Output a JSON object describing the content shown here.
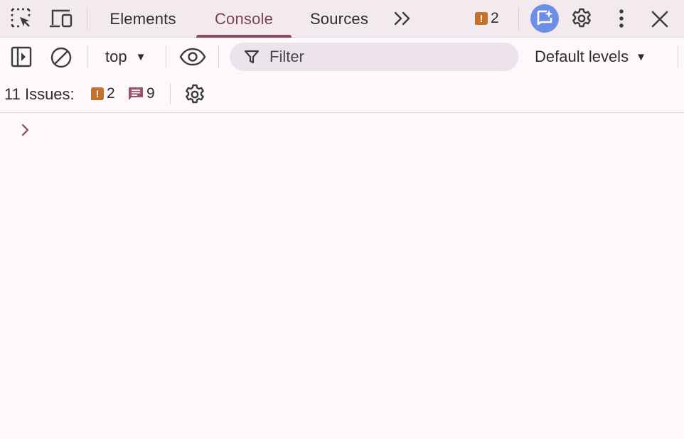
{
  "tabs": [
    {
      "label": "Elements",
      "active": false
    },
    {
      "label": "Console",
      "active": true
    },
    {
      "label": "Sources",
      "active": false
    }
  ],
  "header": {
    "warning_count": "2"
  },
  "console_toolbar": {
    "context": "top",
    "filter_placeholder": "Filter",
    "levels": "Default levels"
  },
  "issues": {
    "label": "11 Issues:",
    "warnings": "2",
    "info": "9"
  },
  "colors": {
    "accent": "#8b4a5b",
    "warning": "#c4712d",
    "info": "#9a5468",
    "ai_button": "#6c8ee6"
  },
  "icons": [
    "inspect-element-icon",
    "device-toolbar-icon",
    "more-tabs-icon",
    "warning-icon",
    "ai-assistant-icon",
    "gear-icon",
    "kebab-menu-icon",
    "close-icon",
    "sidebar-toggle-icon",
    "clear-console-icon",
    "eye-icon",
    "filter-icon",
    "message-icon",
    "chevron-right-icon"
  ]
}
